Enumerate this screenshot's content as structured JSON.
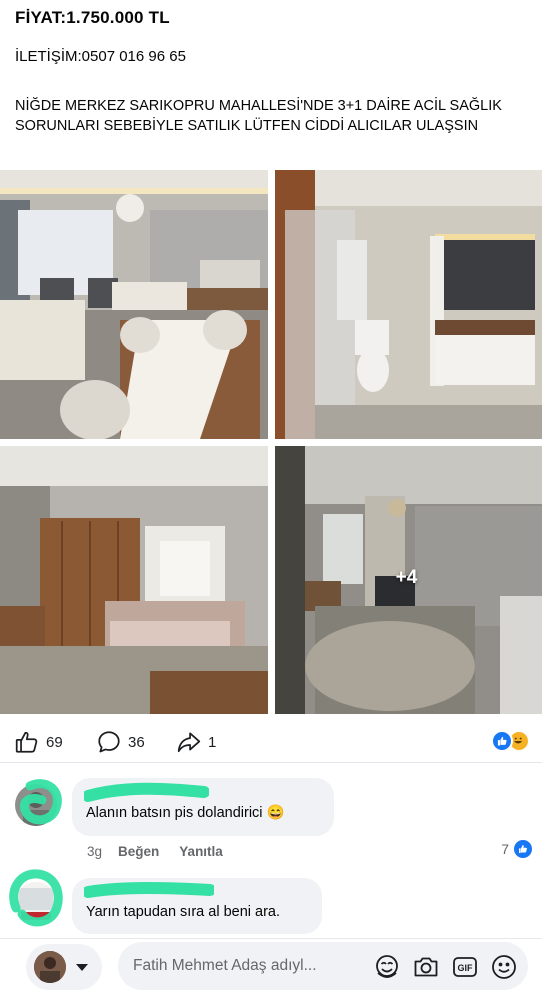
{
  "post": {
    "price": "FİYAT:1.750.000 TL",
    "contact": "İLETİŞİM:0507 016 96 65",
    "description": "NİĞDE MERKEZ SARIKOPRU MAHALLESİ'NDE 3+1 DAİRE ACİL SAĞLIK SORUNLARI SEBEBİYLE SATILIK LÜTFEN CİDDİ ALICILAR ULAŞSIN"
  },
  "photos": {
    "more_label": "+4"
  },
  "actions": {
    "likes": "69",
    "comments": "36",
    "shares": "1"
  },
  "comments": [
    {
      "text": "Alanın batsın pis dolandirici 😄",
      "time": "3g",
      "like_label": "Beğen",
      "reply_label": "Yanıtla",
      "like_count": "7"
    },
    {
      "text": "Yarın tapudan sıra al beni ara."
    }
  ],
  "composer": {
    "placeholder": "Fatih Mehmet Adaş adıyl..."
  },
  "icons": [
    "thumbs-up-icon",
    "comment-icon",
    "share-icon",
    "like-reaction-icon",
    "haha-reaction-icon",
    "avatar-sticker-icon",
    "camera-icon",
    "gif-icon",
    "emoji-icon",
    "chevron-down-icon"
  ],
  "colors": {
    "accent": "#1877f2",
    "bubble": "#f0f2f5",
    "secondary_text": "#65676b",
    "highlight_scribble": "#35e0a4"
  }
}
